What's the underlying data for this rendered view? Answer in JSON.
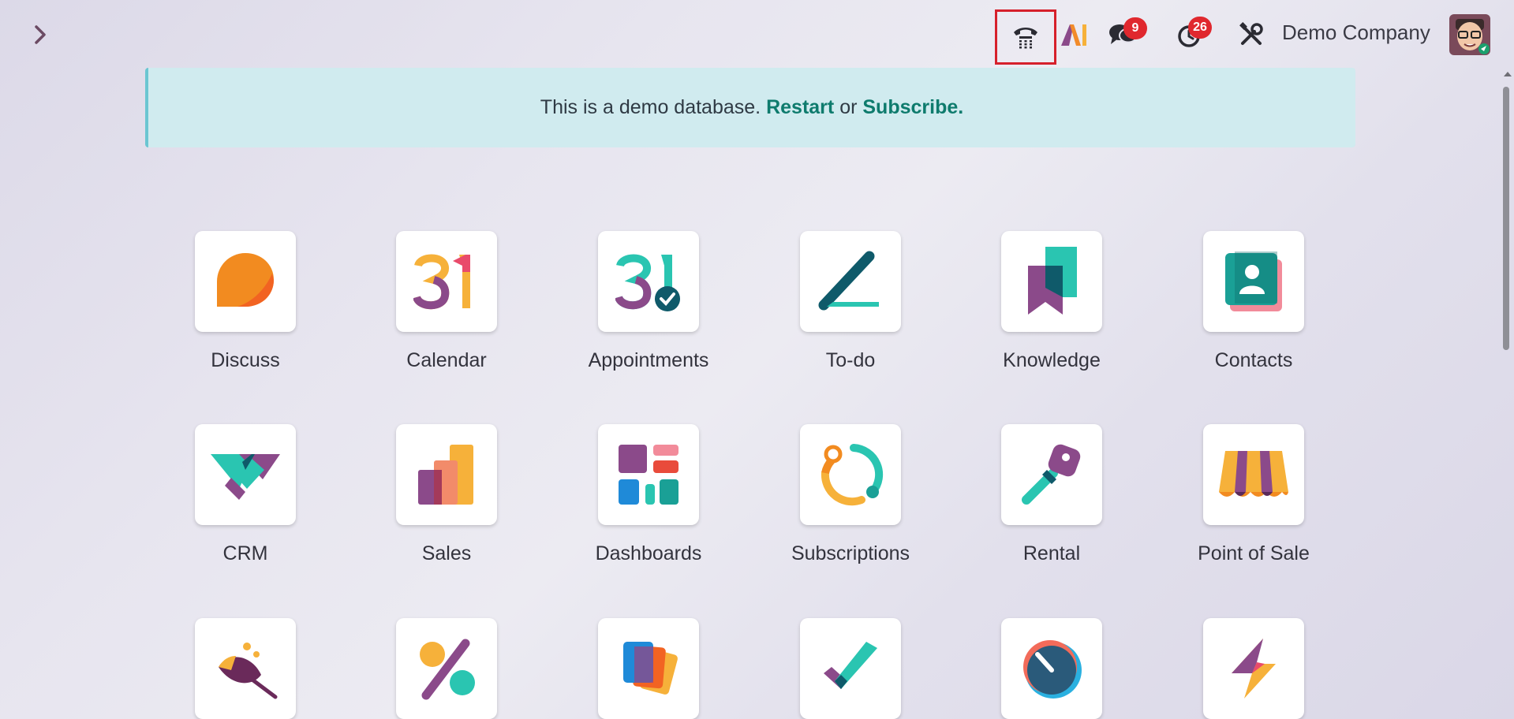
{
  "topbar": {
    "chat_badge": "9",
    "activity_badge": "26",
    "company": "Demo Company"
  },
  "banner": {
    "text_before": "This is a demo database.",
    "restart": "Restart",
    "or": "or",
    "subscribe": "Subscribe."
  },
  "apps": [
    {
      "label": "Discuss",
      "icon": "discuss-icon"
    },
    {
      "label": "Calendar",
      "icon": "calendar-icon"
    },
    {
      "label": "Appointments",
      "icon": "appointments-icon"
    },
    {
      "label": "To-do",
      "icon": "todo-icon"
    },
    {
      "label": "Knowledge",
      "icon": "knowledge-icon"
    },
    {
      "label": "Contacts",
      "icon": "contacts-icon"
    },
    {
      "label": "CRM",
      "icon": "crm-icon"
    },
    {
      "label": "Sales",
      "icon": "sales-icon"
    },
    {
      "label": "Dashboards",
      "icon": "dashboards-icon"
    },
    {
      "label": "Subscriptions",
      "icon": "subscriptions-icon"
    },
    {
      "label": "Rental",
      "icon": "rental-icon"
    },
    {
      "label": "Point of Sale",
      "icon": "point-of-sale-icon"
    }
  ],
  "colors": {
    "accent_link": "#0e7b6d",
    "badge": "#e0282e",
    "highlight_border": "#d6202b",
    "banner_bg": "#d0ebef"
  }
}
